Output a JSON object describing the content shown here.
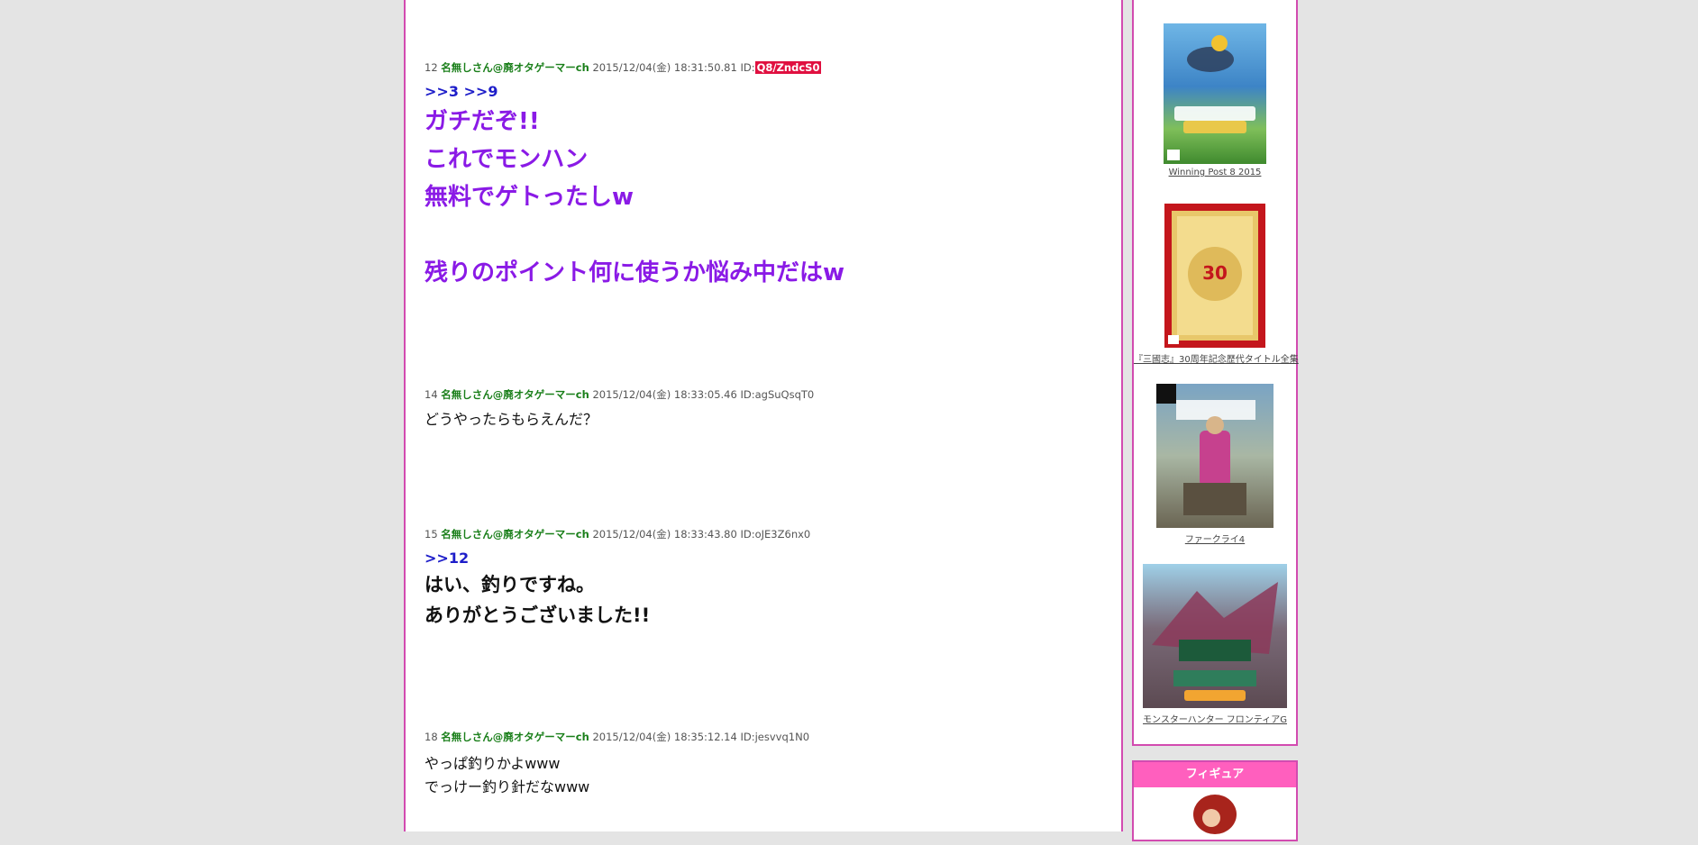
{
  "posts": [
    {
      "num": "12",
      "name": "名無しさん@廃オタゲーマーch",
      "date": "2015/12/04(金) 18:31:50.81",
      "id_label": "ID:",
      "id": "Q8/ZndcS0",
      "anchors": ">>3 >>9",
      "lines": [
        "ガチだぞ!!",
        "これでモンハン",
        "無料でゲトったしw",
        "",
        "残りのポイント何に使うか悩み中だはw"
      ]
    },
    {
      "num": "14",
      "name": "名無しさん@廃オタゲーマーch",
      "date": "2015/12/04(金) 18:33:05.46",
      "id_label": "ID:",
      "id": "agSuQsqT0",
      "lines": [
        "どうやったらもらえんだ？"
      ]
    },
    {
      "num": "15",
      "name": "名無しさん@廃オタゲーマーch",
      "date": "2015/12/04(金) 18:33:43.80",
      "id_label": "ID:",
      "id": "oJE3Z6nx0",
      "anchors": ">>12",
      "lines": [
        "はい、釣りですね。",
        "ありがとうございました!!"
      ]
    },
    {
      "num": "18",
      "name": "名無しさん@廃オタゲーマーch",
      "date": "2015/12/04(金) 18:35:12.14",
      "id_label": "ID:",
      "id": "jesvvq1N0",
      "lines": [
        "やっぱ釣りかよwww",
        "でっけー釣り針だなwww"
      ]
    }
  ],
  "sidebar": {
    "products": [
      {
        "caption": "Winning Post 8 2015"
      },
      {
        "caption": "『三國志』30周年記念歴代タイトル全集"
      },
      {
        "caption": "ファークライ4"
      },
      {
        "caption": "モンスターハンター フロンティアG"
      }
    ],
    "section_title": "フィギュア"
  },
  "colors": {
    "border": "#d24bb0",
    "name": "#1a7f1a",
    "anchor": "#1d1dc9",
    "purple": "#8a1ae6",
    "section_head": "#ff5fbe",
    "id_highlight": "#e01040"
  }
}
